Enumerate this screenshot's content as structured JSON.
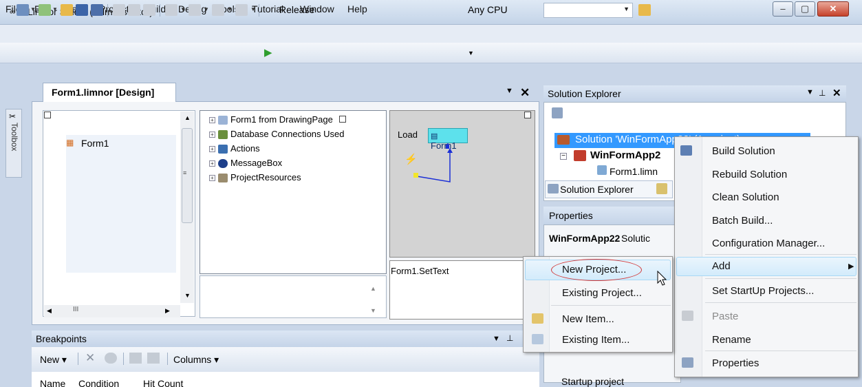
{
  "window": {
    "title": "Limnor Studio (Administrator)"
  },
  "menu": [
    "File",
    "Edit",
    "View",
    "Project",
    "Build",
    "Debug",
    "Tools",
    "Tutorial",
    "Window",
    "Help"
  ],
  "toolbar": {
    "config": "Release",
    "platform": "Any CPU"
  },
  "toolbox": {
    "label": "Toolbox"
  },
  "document": {
    "tab": "Form1.limnor [Design]",
    "form_item": "Form1",
    "tree": [
      "Form1 from DrawingPage",
      "Database Connections Used",
      "Actions",
      "MessageBox",
      "ProjectResources"
    ],
    "event_label": "Load",
    "action_node": "Form1",
    "method": "Form1.SetText"
  },
  "solution_explorer": {
    "title": "Solution Explorer",
    "solution": "Solution 'WinFormApp22' (1 project)",
    "project": "WinFormApp2",
    "file": "Form1.limn",
    "tab": "Solution Explorer"
  },
  "properties": {
    "title": "Properties",
    "subject": "WinFormApp22",
    "type_partial": "Solutic",
    "row": "Startup project"
  },
  "breakpoints": {
    "title": "Breakpoints",
    "new_label": "New",
    "columns_label": "Columns",
    "cols": [
      "Name",
      "Condition",
      "Hit Count"
    ]
  },
  "context_menu": {
    "build": "Build Solution",
    "rebuild": "Rebuild Solution",
    "clean": "Clean Solution",
    "batch": "Batch Build...",
    "config": "Configuration Manager...",
    "add": "Add",
    "startup": "Set StartUp Projects...",
    "paste": "Paste",
    "rename": "Rename",
    "properties": "Properties"
  },
  "submenu": {
    "new_project": "New Project...",
    "existing_project": "Existing Project...",
    "new_item": "New Item...",
    "existing_item": "Existing Item..."
  },
  "colors": {
    "selection": "#3399ff",
    "highlight": "#d3ebfb",
    "cyan_node": "#5de1ec"
  }
}
